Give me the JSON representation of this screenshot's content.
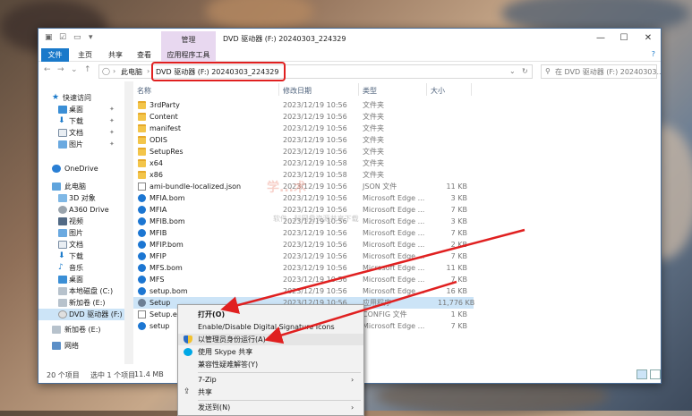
{
  "titlebar": {
    "manage_tab": "管理",
    "title": "DVD 驱动器 (F:) 20240303_224329",
    "qa_items": [
      "▾"
    ]
  },
  "ribbon": {
    "tabs": [
      "文件",
      "主页",
      "共享",
      "查看",
      "应用程序工具"
    ],
    "help": "?"
  },
  "nav": {
    "crumb_root": "此电脑",
    "crumb_drive": "DVD 驱动器 (F:) 20240303_224329",
    "search_placeholder": "在 DVD 驱动器 (F:) 20240303..."
  },
  "sidebar": {
    "items": [
      {
        "label": "快速访问"
      },
      {
        "label": "桌面"
      },
      {
        "label": "下载"
      },
      {
        "label": "文档"
      },
      {
        "label": "图片"
      },
      {
        "label": "OneDrive"
      },
      {
        "label": "此电脑"
      },
      {
        "label": "3D 对象"
      },
      {
        "label": "A360 Drive"
      },
      {
        "label": "视频"
      },
      {
        "label": "图片"
      },
      {
        "label": "文档"
      },
      {
        "label": "下载"
      },
      {
        "label": "音乐"
      },
      {
        "label": "桌面"
      },
      {
        "label": "本地磁盘 (C:)"
      },
      {
        "label": "新加卷 (E:)"
      },
      {
        "label": "DVD 驱动器 (F:)"
      },
      {
        "label": "新加卷 (E:)"
      },
      {
        "label": "网络"
      }
    ]
  },
  "columns": {
    "name": "名称",
    "date": "修改日期",
    "type": "类型",
    "size": "大小"
  },
  "files": [
    {
      "name": "3rdParty",
      "date": "2023/12/19 10:56",
      "type": "文件夹",
      "size": "",
      "icon": "folder-icon"
    },
    {
      "name": "Content",
      "date": "2023/12/19 10:56",
      "type": "文件夹",
      "size": "",
      "icon": "folder-icon"
    },
    {
      "name": "manifest",
      "date": "2023/12/19 10:56",
      "type": "文件夹",
      "size": "",
      "icon": "folder-icon"
    },
    {
      "name": "ODIS",
      "date": "2023/12/19 10:56",
      "type": "文件夹",
      "size": "",
      "icon": "folder-icon"
    },
    {
      "name": "SetupRes",
      "date": "2023/12/19 10:56",
      "type": "文件夹",
      "size": "",
      "icon": "folder-icon"
    },
    {
      "name": "x64",
      "date": "2023/12/19 10:58",
      "type": "文件夹",
      "size": "",
      "icon": "folder-icon"
    },
    {
      "name": "x86",
      "date": "2023/12/19 10:58",
      "type": "文件夹",
      "size": "",
      "icon": "folder-icon"
    },
    {
      "name": "ami-bundle-localized.json",
      "date": "2023/12/19 10:56",
      "type": "JSON 文件",
      "size": "11 KB",
      "icon": "file-icon"
    },
    {
      "name": "MFIA.bom",
      "date": "2023/12/19 10:56",
      "type": "Microsoft Edge ...",
      "size": "3 KB",
      "icon": "edge-icon"
    },
    {
      "name": "MFIA",
      "date": "2023/12/19 10:56",
      "type": "Microsoft Edge ...",
      "size": "7 KB",
      "icon": "edge-icon"
    },
    {
      "name": "MFIB.bom",
      "date": "2023/12/19 10:56",
      "type": "Microsoft Edge ...",
      "size": "3 KB",
      "icon": "edge-icon"
    },
    {
      "name": "MFIB",
      "date": "2023/12/19 10:56",
      "type": "Microsoft Edge ...",
      "size": "7 KB",
      "icon": "edge-icon"
    },
    {
      "name": "MFIP.bom",
      "date": "2023/12/19 10:56",
      "type": "Microsoft Edge ...",
      "size": "2 KB",
      "icon": "edge-icon"
    },
    {
      "name": "MFIP",
      "date": "2023/12/19 10:56",
      "type": "Microsoft Edge ...",
      "size": "7 KB",
      "icon": "edge-icon"
    },
    {
      "name": "MFS.bom",
      "date": "2023/12/19 10:56",
      "type": "Microsoft Edge ...",
      "size": "11 KB",
      "icon": "edge-icon"
    },
    {
      "name": "MFS",
      "date": "2023/12/19 10:56",
      "type": "Microsoft Edge ...",
      "size": "7 KB",
      "icon": "edge-icon"
    },
    {
      "name": "setup.bom",
      "date": "2023/12/19 10:56",
      "type": "Microsoft Edge ...",
      "size": "16 KB",
      "icon": "edge-icon"
    },
    {
      "name": "Setup",
      "date": "2023/12/19 10:56",
      "type": "应用程序",
      "size": "11,776 KB",
      "icon": "setup-icon"
    },
    {
      "name": "Setup.exe",
      "date": "",
      "type": "CONFIG 文件",
      "size": "1 KB",
      "icon": "file-icon"
    },
    {
      "name": "setup",
      "date": "",
      "type": "Microsoft Edge ...",
      "size": "7 KB",
      "icon": "edge-icon"
    }
  ],
  "status": {
    "count": "20 个项目",
    "selected": "选中 1 个项目",
    "size": "11.4 MB"
  },
  "watermark": {
    "main": "学...术",
    "sub": "软件...料网盘资源共享下载"
  },
  "context_menu": {
    "items": [
      {
        "label": "打开(O)",
        "bold": true,
        "icon": "",
        "submenu": false
      },
      {
        "label": "Enable/Disable Digital Signature Icons",
        "icon": "",
        "submenu": false
      },
      {
        "label": "以管理员身份运行(A)",
        "icon": "shield-icon",
        "submenu": false
      },
      {
        "label": "使用 Skype 共享",
        "icon": "skype-icon",
        "submenu": false
      },
      {
        "label": "兼容性疑难解答(Y)",
        "icon": "",
        "submenu": false
      },
      {
        "label": "7-Zip",
        "icon": "",
        "submenu": true
      },
      {
        "label": "共享",
        "icon": "share-icon",
        "submenu": false
      },
      {
        "label": "发送到(N)",
        "icon": "",
        "submenu": true
      }
    ]
  },
  "colors": {
    "accent": "#1979ca",
    "highlight": "#cce4f7",
    "annotation_red": "#e02020"
  }
}
